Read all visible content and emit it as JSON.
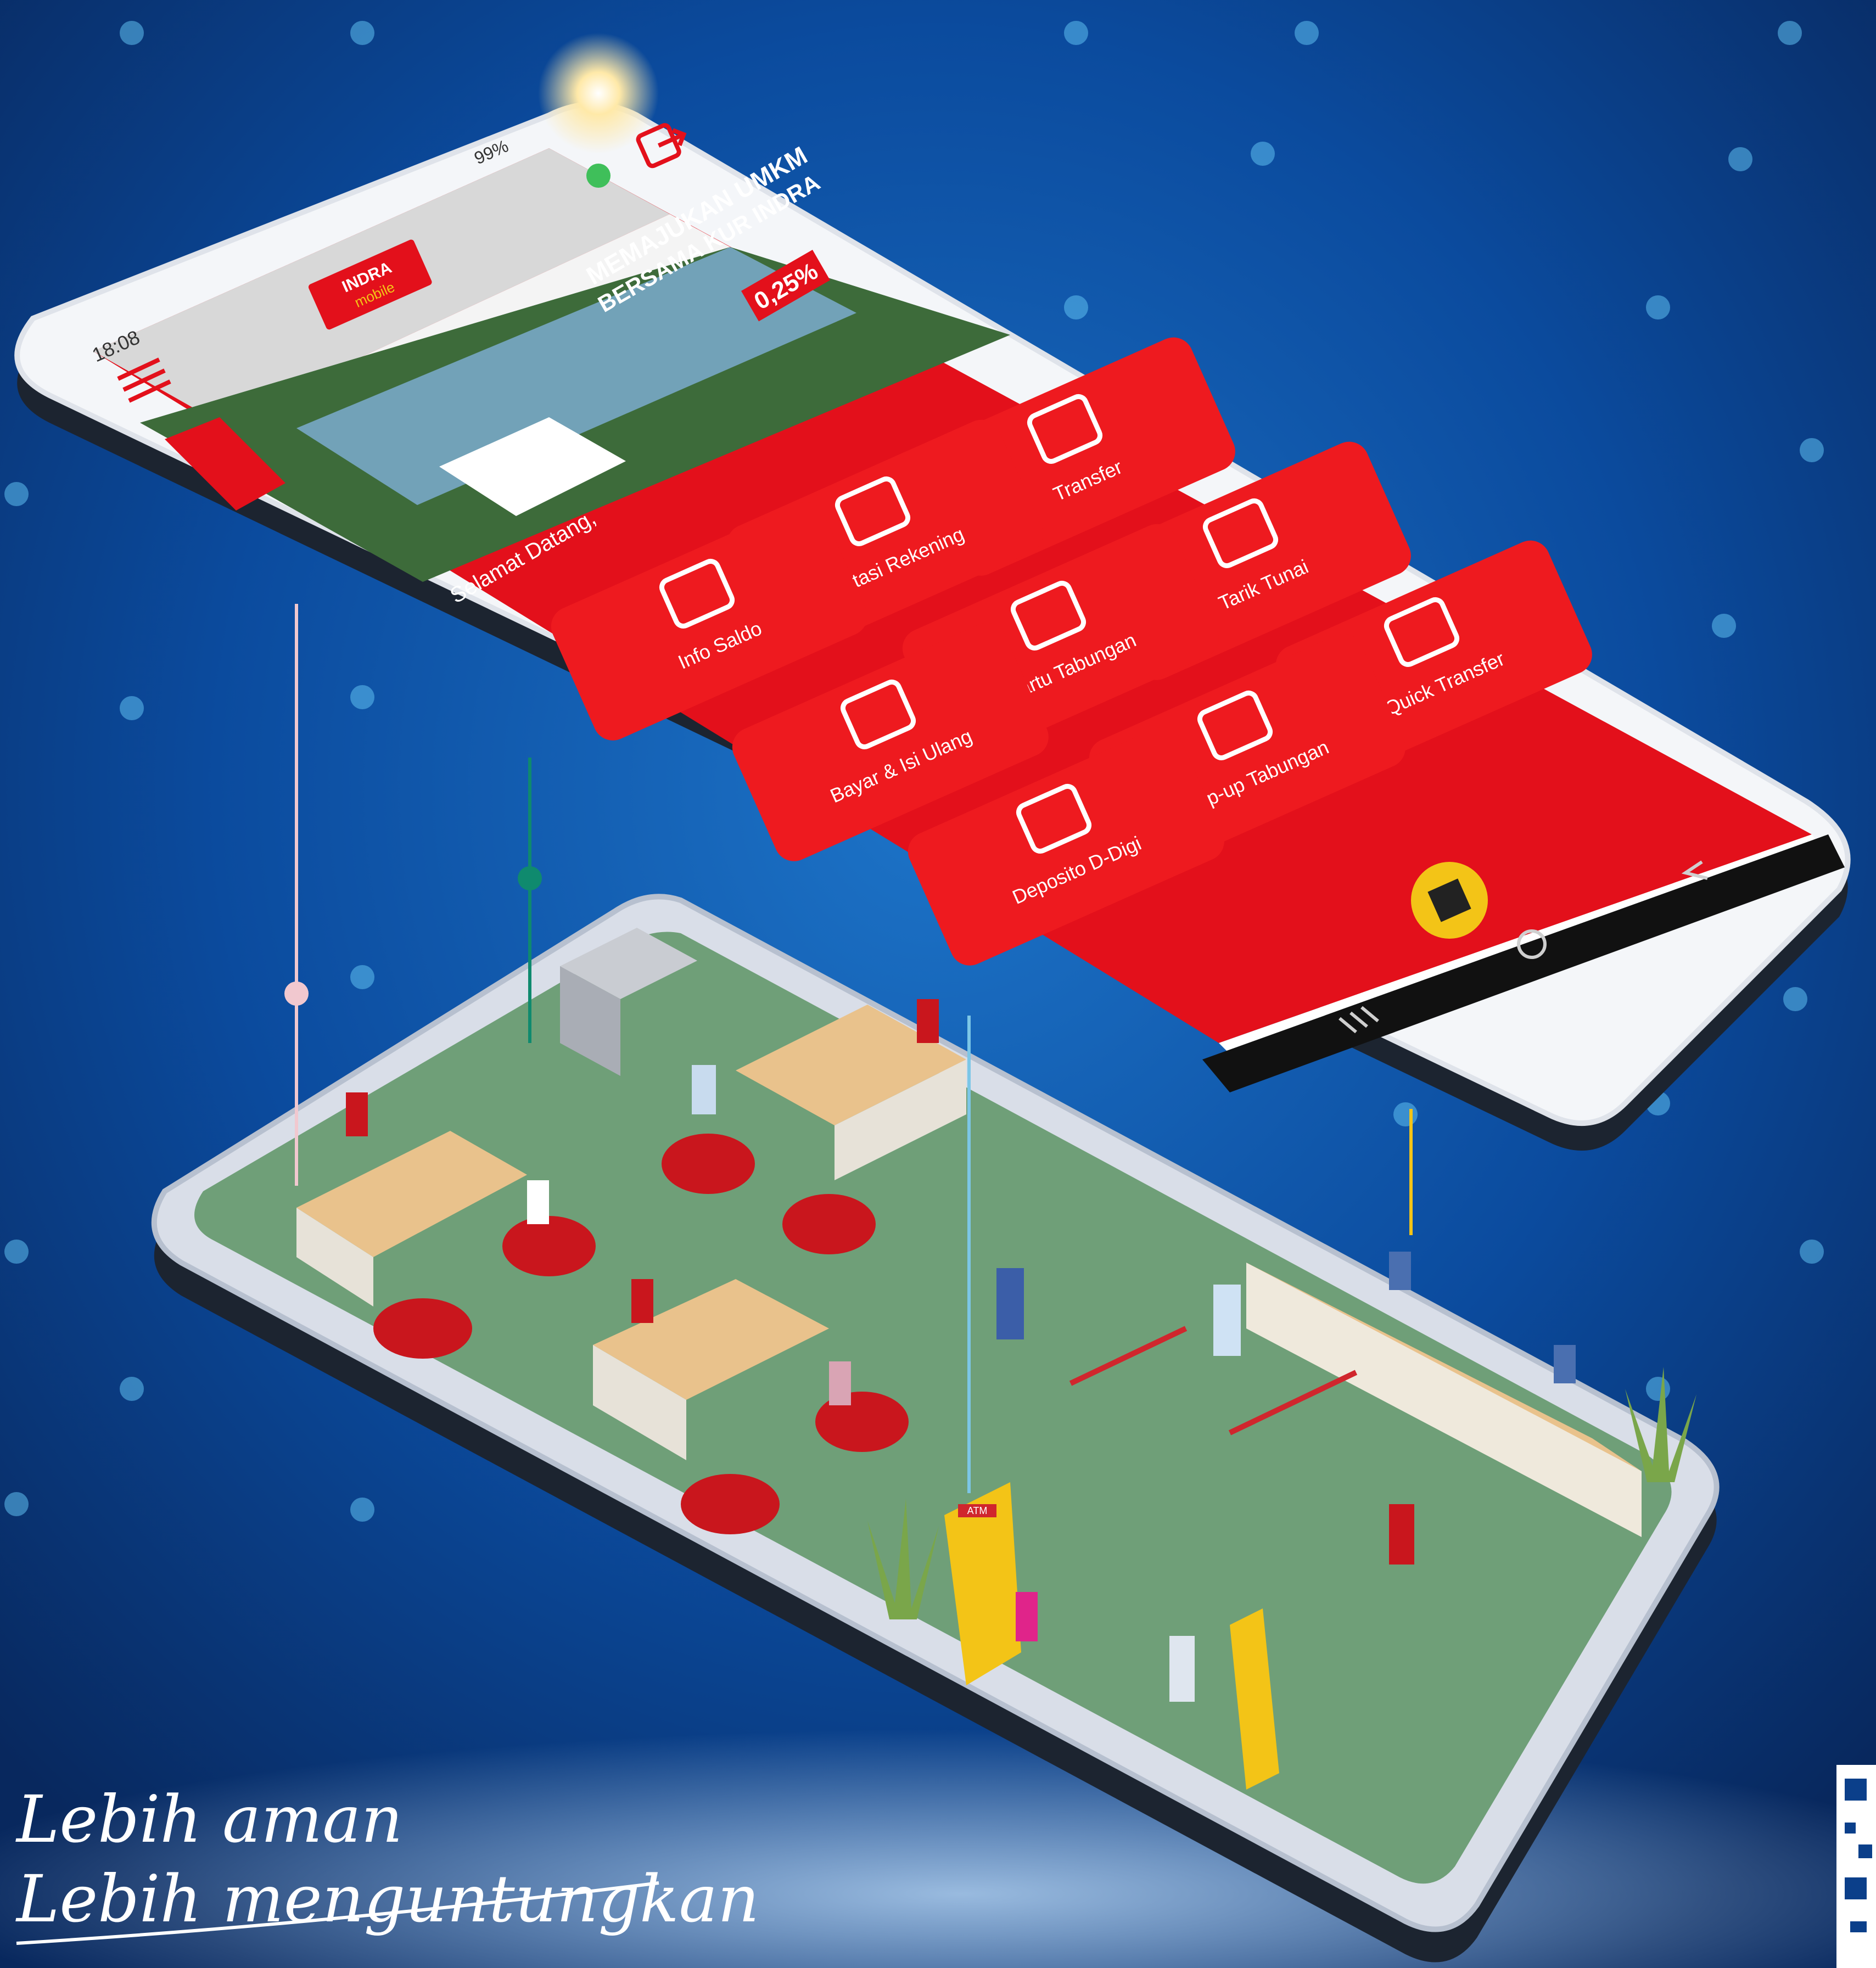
{
  "status_bar": {
    "time": "18:08",
    "battery": "99%"
  },
  "app": {
    "logo_line1": "INDRA",
    "logo_line2": "mobile",
    "greeting": "Selamat Datang,"
  },
  "banner": {
    "headline_line1": "MEMAJUKAN UMKM",
    "headline_line2": "BERSAMA KUR INDRA",
    "rate": "0,25%"
  },
  "menu_items": [
    {
      "label": "Transfer",
      "icon": "transfer-icon"
    },
    {
      "label": "Mutasi Rekening",
      "icon": "wallet-icon"
    },
    {
      "label": "Tarik Tunai",
      "icon": "atm-withdraw-icon"
    },
    {
      "label": "Info Saldo",
      "icon": "wallet-icon"
    },
    {
      "label": "Kartu Tabungan",
      "icon": "qr-code-icon"
    },
    {
      "label": "Quick Transfer",
      "icon": "quick-transfer-icon"
    },
    {
      "label": "Bayar & Isi Ulang",
      "icon": "tap-phone-icon"
    },
    {
      "label": "Top-up Tabungan",
      "icon": "topup-icon"
    },
    {
      "label": "Deposito D-Digi",
      "icon": "building-icon"
    }
  ],
  "scene": {
    "atm_sign": "ATM"
  },
  "tagline": {
    "line1": "Lebih aman",
    "line2": "Lebih menguntungkan"
  },
  "colors": {
    "background": "#0b3f8a",
    "app_red": "#e3101b",
    "tile_red": "#ee1a1f",
    "floor_green": "#6f9f78",
    "accent_yellow": "#f3c417"
  }
}
